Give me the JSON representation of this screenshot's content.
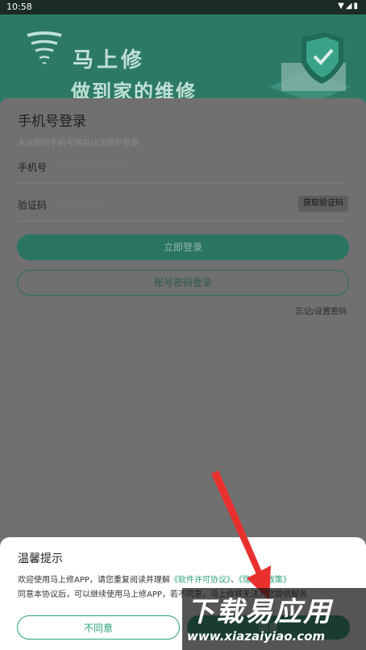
{
  "status_bar": {
    "time": "10:58",
    "icons": "▼◢▮"
  },
  "banner": {
    "brand": "马上修",
    "slogan": "做到家的维修"
  },
  "login": {
    "title": "手机号登录",
    "subtitle": "未注册的手机号将自动注册并登录",
    "phone_label": "手机号",
    "phone_placeholder": "请输入注册手机号码",
    "code_label": "验证码",
    "code_placeholder": "请输入验证码",
    "get_code_button": "获取验证码",
    "login_button": "立即登录",
    "account_login_button": "账号密码登录",
    "forgot_password": "忘记/设置密码"
  },
  "dialog": {
    "title": "温馨提示",
    "line1_prefix": "欢迎使用马上修APP，请您重复阅读并理解",
    "license_link": "《软件许可协议》",
    "and_text": "、",
    "privacy_link": "《隐私权政策》",
    "line2": "同意本协议后，可以继续使用马上修APP，若不同意，马上修将无法为您提供服务",
    "disagree_button": "不同意",
    "agree_button": "同意"
  },
  "watermark": {
    "line1": "下载易应用",
    "line2": "www.xiazaiyiao.com"
  },
  "colors": {
    "accent": "#2aa07e",
    "banner": "#2c7a66",
    "overlay": "#6b6b6b"
  }
}
